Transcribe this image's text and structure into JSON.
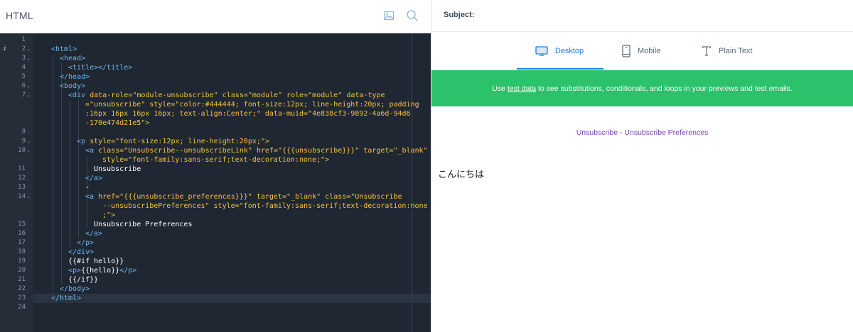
{
  "editor": {
    "title": "HTML",
    "icons": {
      "image": "image-icon",
      "search": "search-icon"
    },
    "gutter": [
      {
        "n": "1"
      },
      {
        "n": "2",
        "fold": true,
        "info": true
      },
      {
        "n": "3",
        "fold": true
      },
      {
        "n": "4"
      },
      {
        "n": "5"
      },
      {
        "n": "6",
        "fold": true
      },
      {
        "n": "7",
        "fold": true
      },
      {
        "n": ""
      },
      {
        "n": ""
      },
      {
        "n": ""
      },
      {
        "n": "8"
      },
      {
        "n": "9",
        "fold": true
      },
      {
        "n": "10",
        "fold": true
      },
      {
        "n": ""
      },
      {
        "n": "11"
      },
      {
        "n": "12"
      },
      {
        "n": "13"
      },
      {
        "n": "14",
        "fold": true
      },
      {
        "n": ""
      },
      {
        "n": ""
      },
      {
        "n": "15"
      },
      {
        "n": "16"
      },
      {
        "n": "17"
      },
      {
        "n": "18"
      },
      {
        "n": "19"
      },
      {
        "n": "20"
      },
      {
        "n": "21"
      },
      {
        "n": "22"
      },
      {
        "n": "23"
      },
      {
        "n": "24"
      }
    ],
    "lines": [
      {
        "indent": 0,
        "tokens": []
      },
      {
        "indent": 1,
        "tokens": [
          {
            "c": "tag",
            "t": "<html>"
          }
        ]
      },
      {
        "indent": 2,
        "tokens": [
          {
            "c": "tag",
            "t": "<head>"
          }
        ]
      },
      {
        "indent": 3,
        "tokens": [
          {
            "c": "tag",
            "t": "<title></title>"
          }
        ]
      },
      {
        "indent": 2,
        "tokens": [
          {
            "c": "tag",
            "t": "</head>"
          }
        ]
      },
      {
        "indent": 2,
        "tokens": [
          {
            "c": "tag",
            "t": "<body>"
          }
        ]
      },
      {
        "indent": 3,
        "tokens": [
          {
            "c": "tag",
            "t": "<div "
          },
          {
            "c": "attr",
            "t": "data-role=\"module-unsubscribe\" class=\"module\" role=\"module\" data-type"
          }
        ]
      },
      {
        "indent": 5,
        "tokens": [
          {
            "c": "attr",
            "t": "=\"unsubscribe\" style=\"color:#444444; font-size:12px; line-height:20px; padding"
          }
        ]
      },
      {
        "indent": 5,
        "tokens": [
          {
            "c": "attr",
            "t": ":16px 16px 16px 16px; text-align:Center;\" data-muid=\"4e838cf3-9892-4a6d-94d6"
          }
        ]
      },
      {
        "indent": 5,
        "tokens": [
          {
            "c": "attr",
            "t": "-170e474d21e5\">"
          }
        ]
      },
      {
        "indent": 0,
        "tokens": []
      },
      {
        "indent": 4,
        "tokens": [
          {
            "c": "tag",
            "t": "<p "
          },
          {
            "c": "attr",
            "t": "style=\"font-size:12px; line-height:20px;\">"
          }
        ]
      },
      {
        "indent": 5,
        "tokens": [
          {
            "c": "tag",
            "t": "<a "
          },
          {
            "c": "attr",
            "t": "class=\"Unsubscribe--unsubscribeLink\" href=\"{{{unsubscribe}}}\" target=\"_blank\""
          }
        ]
      },
      {
        "indent": 7,
        "tokens": [
          {
            "c": "attr",
            "t": "style=\"font-family:sans-serif;text-decoration:none;\">"
          }
        ]
      },
      {
        "indent": 6,
        "tokens": [
          {
            "c": "text",
            "t": "Unsubscribe"
          }
        ]
      },
      {
        "indent": 5,
        "tokens": [
          {
            "c": "tag",
            "t": "</a>"
          }
        ]
      },
      {
        "indent": 5,
        "tokens": [
          {
            "c": "text",
            "t": "-"
          }
        ]
      },
      {
        "indent": 5,
        "tokens": [
          {
            "c": "tag",
            "t": "<a "
          },
          {
            "c": "attr",
            "t": "href=\"{{{unsubscribe_preferences}}}\" target=\"_blank\" class=\"Unsubscribe"
          }
        ]
      },
      {
        "indent": 7,
        "tokens": [
          {
            "c": "attr",
            "t": "--unsubscribePreferences\" style=\"font-family:sans-serif;text-decoration:none"
          }
        ]
      },
      {
        "indent": 7,
        "tokens": [
          {
            "c": "attr",
            "t": ";\">"
          }
        ]
      },
      {
        "indent": 6,
        "tokens": [
          {
            "c": "text",
            "t": "Unsubscribe Preferences"
          }
        ]
      },
      {
        "indent": 5,
        "tokens": [
          {
            "c": "tag",
            "t": "</a>"
          }
        ]
      },
      {
        "indent": 4,
        "tokens": [
          {
            "c": "tag",
            "t": "</p>"
          }
        ]
      },
      {
        "indent": 3,
        "tokens": [
          {
            "c": "tag",
            "t": "</div>"
          }
        ]
      },
      {
        "indent": 3,
        "tokens": [
          {
            "c": "text",
            "t": "{{#if hello}}"
          }
        ]
      },
      {
        "indent": 3,
        "tokens": [
          {
            "c": "tag",
            "t": "<p>"
          },
          {
            "c": "text",
            "t": "{{hello}}"
          },
          {
            "c": "tag",
            "t": "</p>"
          }
        ]
      },
      {
        "indent": 3,
        "tokens": [
          {
            "c": "text",
            "t": "{{/if}}"
          }
        ]
      },
      {
        "indent": 2,
        "tokens": [
          {
            "c": "tag",
            "t": "</body>"
          }
        ]
      },
      {
        "indent": 1,
        "tokens": [
          {
            "c": "tag",
            "t": "</html>"
          }
        ],
        "active": true
      },
      {
        "indent": 0,
        "tokens": []
      }
    ]
  },
  "preview": {
    "subject_label": "Subject:",
    "tabs": [
      {
        "label": "Desktop",
        "icon": "monitor-icon",
        "active": true
      },
      {
        "label": "Mobile",
        "icon": "phone-icon",
        "active": false
      },
      {
        "label": "Plain Text",
        "icon": "text-type-icon",
        "active": false
      }
    ],
    "banner": {
      "prefix": "Use ",
      "link": "test data",
      "suffix": " to see substitutions, conditionals, and loops in your previews and test emails."
    },
    "unsubscribe": {
      "link1": "Unsubscribe",
      "separator": " - ",
      "link2": "Unsubscribe Preferences"
    },
    "hello_text": "こんにちは"
  },
  "colors": {
    "editor_bg": "#1f2732",
    "tag": "#6cb8f0",
    "attr": "#f5c23b",
    "accent": "#1a82e2",
    "banner": "#2bc26b",
    "link": "#7a3fb0"
  }
}
